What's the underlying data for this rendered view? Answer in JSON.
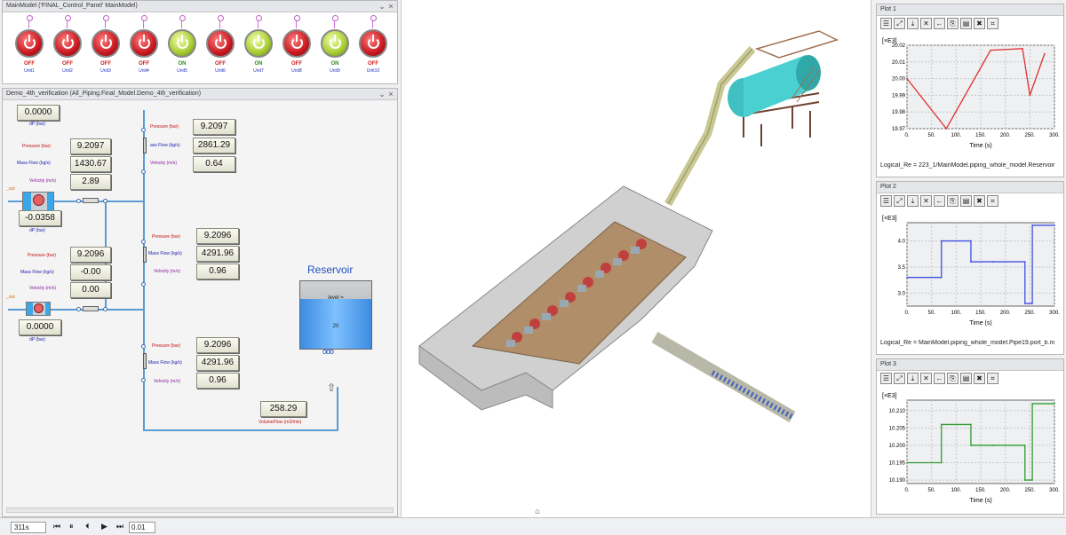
{
  "control_panel": {
    "title": "MainModel ('FINAL_Control_Panel' MainModel)",
    "lamps": [
      {
        "state": "OFF",
        "unit": "Unit1"
      },
      {
        "state": "OFF",
        "unit": "Unit2"
      },
      {
        "state": "OFF",
        "unit": "Unit3"
      },
      {
        "state": "OFF",
        "unit": "Unit4"
      },
      {
        "state": "ON",
        "unit": "Unit5"
      },
      {
        "state": "OFF",
        "unit": "Unit6"
      },
      {
        "state": "ON",
        "unit": "Unit7"
      },
      {
        "state": "OFF",
        "unit": "Unit8"
      },
      {
        "state": "ON",
        "unit": "Unit9"
      },
      {
        "state": "OFF",
        "unit": "Unit10"
      }
    ],
    "colors": {
      "off": "#c81820",
      "on": "#a6cc30"
    }
  },
  "piping": {
    "title": "Demo_4th_verification (All_Piping.Final_Model.Demo_4th_verification)",
    "dp_top": {
      "value": "0.0000",
      "label": "dP (bar)"
    },
    "left_upper": {
      "pressure_label": "Pressure (bar)",
      "pressure": "9.2097",
      "mass_label": "Mass Flow (kg/s)",
      "mass": "1430.67",
      "vel_label": "Velocity (m/s)",
      "vel": "2.89"
    },
    "valve1": {
      "label": "_out",
      "value": "-0.0358",
      "dp_label": "dP (bar)"
    },
    "left_lower": {
      "pressure_label": "Pressure (bar)",
      "pressure": "9.2096",
      "mass_label": "Mass Flow (kg/s)",
      "mass": "-0.00",
      "vel_label": "Velocity (m/s)",
      "vel": "0.00"
    },
    "valve2": {
      "label": "_out",
      "value": "0.0000",
      "dp_label": "dP (bar)"
    },
    "mid_1": {
      "pressure_label": "Pressure (bar)",
      "pressure": "9.2097",
      "mass_label": "ass Flow (kg/s)",
      "mass": "2861.29",
      "vel_label": "Velocity (m/s)",
      "vel": "0.64"
    },
    "mid_2": {
      "pressure_label": "Pressure (bar)",
      "pressure": "9.2096",
      "mass_label": "Mass Flow (kg/s)",
      "mass": "4291.96",
      "vel_label": "Velocity (m/s)",
      "vel": "0.96"
    },
    "mid_3": {
      "pressure_label": "Pressure (bar)",
      "pressure": "9.2096",
      "mass_label": "Mass Flow (kg/s)",
      "mass": "4291.96",
      "vel_label": "Velocity (m/s)",
      "vel": "0.96"
    },
    "reservoir": {
      "title": "Reservoir",
      "level_label": "level =",
      "level_value": "20"
    },
    "volume_flow": {
      "value": "258.29",
      "label": "VolumeFlow (m3/min)"
    }
  },
  "plots": [
    {
      "title": "Plot 1",
      "unit": "[×E3]",
      "footer": "Logical_Re = 223_1/MainModel.piping_whole_model.Reservoir",
      "chart_data": {
        "type": "line",
        "x": [
          0,
          80,
          170,
          235,
          250,
          280
        ],
        "values": [
          20.0,
          19.97,
          20.017,
          20.018,
          19.99,
          20.015
        ],
        "yticks": [
          "20.02",
          "20.01",
          "20.00",
          "19.99",
          "19.98",
          "19.97"
        ],
        "ylim": [
          19.97,
          20.02
        ],
        "xlim": [
          0,
          300
        ],
        "xticks": [
          "0.",
          "50.",
          "100.",
          "150.",
          "200.",
          "250.",
          "300."
        ],
        "xlabel": "Time (s)",
        "color": "#e03030"
      }
    },
    {
      "title": "Plot 2",
      "unit": "[×E3]",
      "footer": "Logical_Re = MainModel.piping_whole_model.Pipe19.port_b.m",
      "chart_data": {
        "type": "line",
        "x": [
          0,
          70,
          70,
          130,
          130,
          175,
          175,
          240,
          240,
          255,
          255,
          300
        ],
        "values": [
          3.3,
          3.3,
          4.0,
          4.0,
          3.6,
          3.6,
          3.6,
          3.6,
          2.8,
          2.8,
          4.3,
          4.3
        ],
        "yticks": [
          "4.0",
          "3.5",
          "3.0"
        ],
        "ylim": [
          2.75,
          4.35
        ],
        "xlim": [
          0,
          300
        ],
        "xticks": [
          "0.",
          "50.",
          "100.",
          "150.",
          "200.",
          "250.",
          "300."
        ],
        "xlabel": "Time (s)",
        "color": "#4050e0"
      }
    },
    {
      "title": "Plot 3",
      "unit": "[×E3]",
      "footer": "",
      "chart_data": {
        "type": "line",
        "x": [
          0,
          70,
          70,
          130,
          130,
          175,
          175,
          240,
          240,
          255,
          255,
          300
        ],
        "values": [
          10.195,
          10.195,
          10.206,
          10.206,
          10.2,
          10.2,
          10.2,
          10.2,
          10.19,
          10.19,
          10.212,
          10.212
        ],
        "yticks": [
          "10.210",
          "10.205",
          "10.200",
          "10.195",
          "10.190"
        ],
        "ylim": [
          10.189,
          10.213
        ],
        "xlim": [
          0,
          300
        ],
        "xticks": [
          "0.",
          "50.",
          "100.",
          "150.",
          "200.",
          "250.",
          "300."
        ],
        "xlabel": "Time (s)",
        "color": "#309a30"
      }
    }
  ],
  "status": {
    "time": "311s",
    "step": "0.01"
  }
}
